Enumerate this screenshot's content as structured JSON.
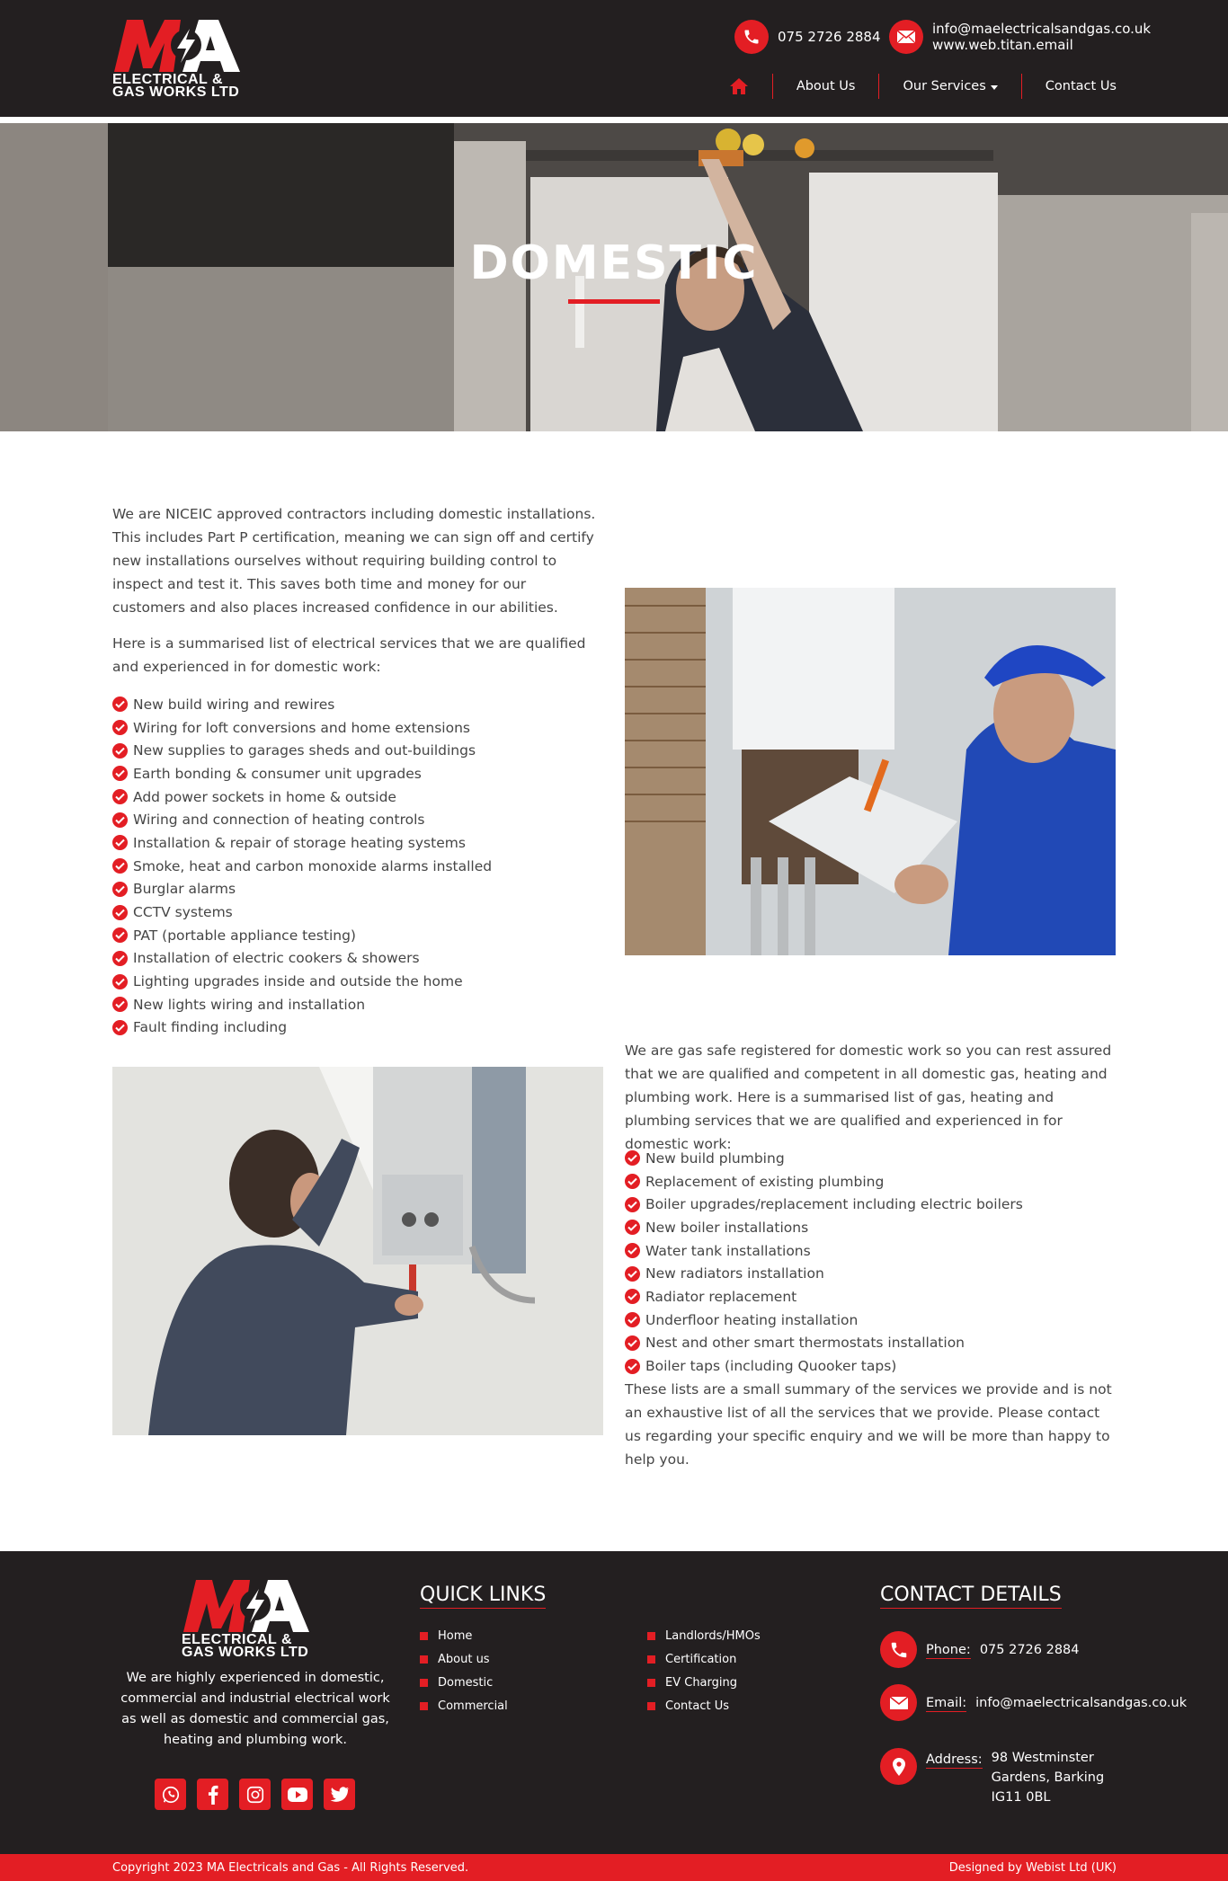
{
  "header": {
    "phone": "075 2726 2884",
    "email": "info@maelectricalsandgas.co.uk",
    "website": "www.web.titan.email",
    "logo": {
      "mark": "MA",
      "line1": "ELECTRICAL &",
      "line2": "GAS WORKS LTD"
    },
    "nav": {
      "home_icon": "home-icon",
      "about": "About Us",
      "services": "Our Services",
      "contact": "Contact Us"
    }
  },
  "hero": {
    "title": "DOMESTIC"
  },
  "electrical": {
    "intro": "We are NICEIC approved contractors including domestic installations. This includes Part P certification, meaning we can sign off and certify new installations ourselves without requiring building control to inspect and test it. This saves both time and money for our customers and also places increased confidence in our abilities.",
    "list_intro": "Here is a summarised list of electrical services that we are qualified and experienced in for domestic work:",
    "items": [
      "New build wiring and rewires",
      "Wiring for loft conversions and home extensions",
      "New supplies to garages sheds and out-buildings",
      "Earth bonding & consumer unit upgrades",
      "Add power sockets in home & outside",
      "Wiring and connection of heating controls",
      "Installation & repair of storage heating systems",
      "Smoke, heat and carbon monoxide alarms installed",
      "Burglar alarms",
      "CCTV systems",
      "PAT (portable appliance testing)",
      "Installation of electric cookers & showers",
      "Lighting upgrades inside and outside the home",
      "New lights wiring and installation",
      "Fault finding including"
    ]
  },
  "gas": {
    "intro": "We are gas safe registered for domestic work so you can rest assured that we are qualified and competent in all domestic gas, heating and plumbing work. Here is a summarised list of gas, heating and plumbing services that we are qualified and experienced in for domestic work:",
    "items": [
      "New build plumbing",
      "Replacement of existing plumbing",
      "Boiler upgrades/replacement including electric boilers",
      "New boiler installations",
      "Water tank installations",
      "New radiators installation",
      "Radiator replacement",
      "Underfloor heating installation",
      "Nest and other smart thermostats installation",
      "Boiler taps (including Quooker taps)"
    ],
    "closing": "These lists are a small summary of the services we provide and is not an exhaustive list of all the services that we provide. Please contact us regarding your specific enquiry and we will be more than happy to help you."
  },
  "footer": {
    "description": "We are highly experienced in domestic, commercial and industrial electrical work as well as domestic and commercial gas, heating and plumbing work.",
    "quick_links_title": "QUICK LINKS",
    "links_col1": [
      "Home",
      "About us",
      "Domestic",
      "Commercial"
    ],
    "links_col2": [
      "Landlords/HMOs",
      "Certification",
      "EV Charging",
      "Contact Us"
    ],
    "contact_title": "CONTACT DETAILS",
    "phone_label": "Phone:",
    "phone": "075 2726 2884",
    "email_label": "Email:",
    "email": "info@maelectricalsandgas.co.uk",
    "address_label": "Address:",
    "address": "98 Westminster Gardens, Barking IG11 0BL",
    "socials": [
      "whatsapp-icon",
      "facebook-icon",
      "instagram-icon",
      "youtube-icon",
      "twitter-icon"
    ],
    "copyright": "Copyright 2023 MA Electricals and Gas - All Rights Reserved.",
    "designed_by": "Designed by Webist Ltd (UK)"
  },
  "colors": {
    "brand_red": "#e31e24",
    "dark": "#231f20"
  }
}
